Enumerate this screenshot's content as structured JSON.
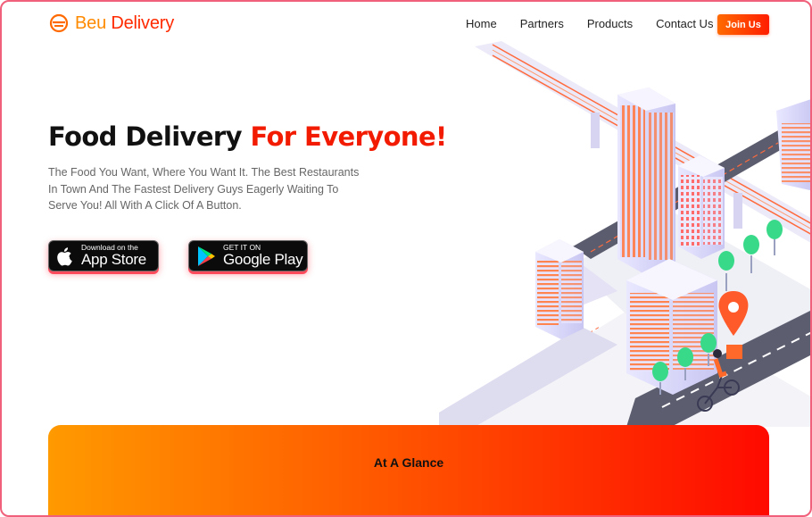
{
  "brand": {
    "name_part1": "Beu",
    "name_part2": "Delivery",
    "icon": "food-bowl-icon",
    "colors": {
      "orange": "#ff8a00",
      "red": "#ff2a00"
    }
  },
  "nav": {
    "items": [
      {
        "label": "Home"
      },
      {
        "label": "Partners"
      },
      {
        "label": "Products"
      },
      {
        "label": "Contact Us"
      }
    ],
    "join_label": "Join Us"
  },
  "hero": {
    "title_part1": "Food Delivery",
    "title_part2": "For Everyone!",
    "subtitle": "The Food You Want, Where You Want It. The Best Restaurants In Town And The Fastest Delivery Guys Eagerly Waiting To Serve You! All With A Click Of A Button."
  },
  "stores": {
    "apple": {
      "small": "Download on the",
      "big": "App Store",
      "icon": "apple-icon"
    },
    "google": {
      "small": "GET IT ON",
      "big": "Google Play",
      "icon": "google-play-icon"
    }
  },
  "glance": {
    "title": "At A Glance"
  }
}
